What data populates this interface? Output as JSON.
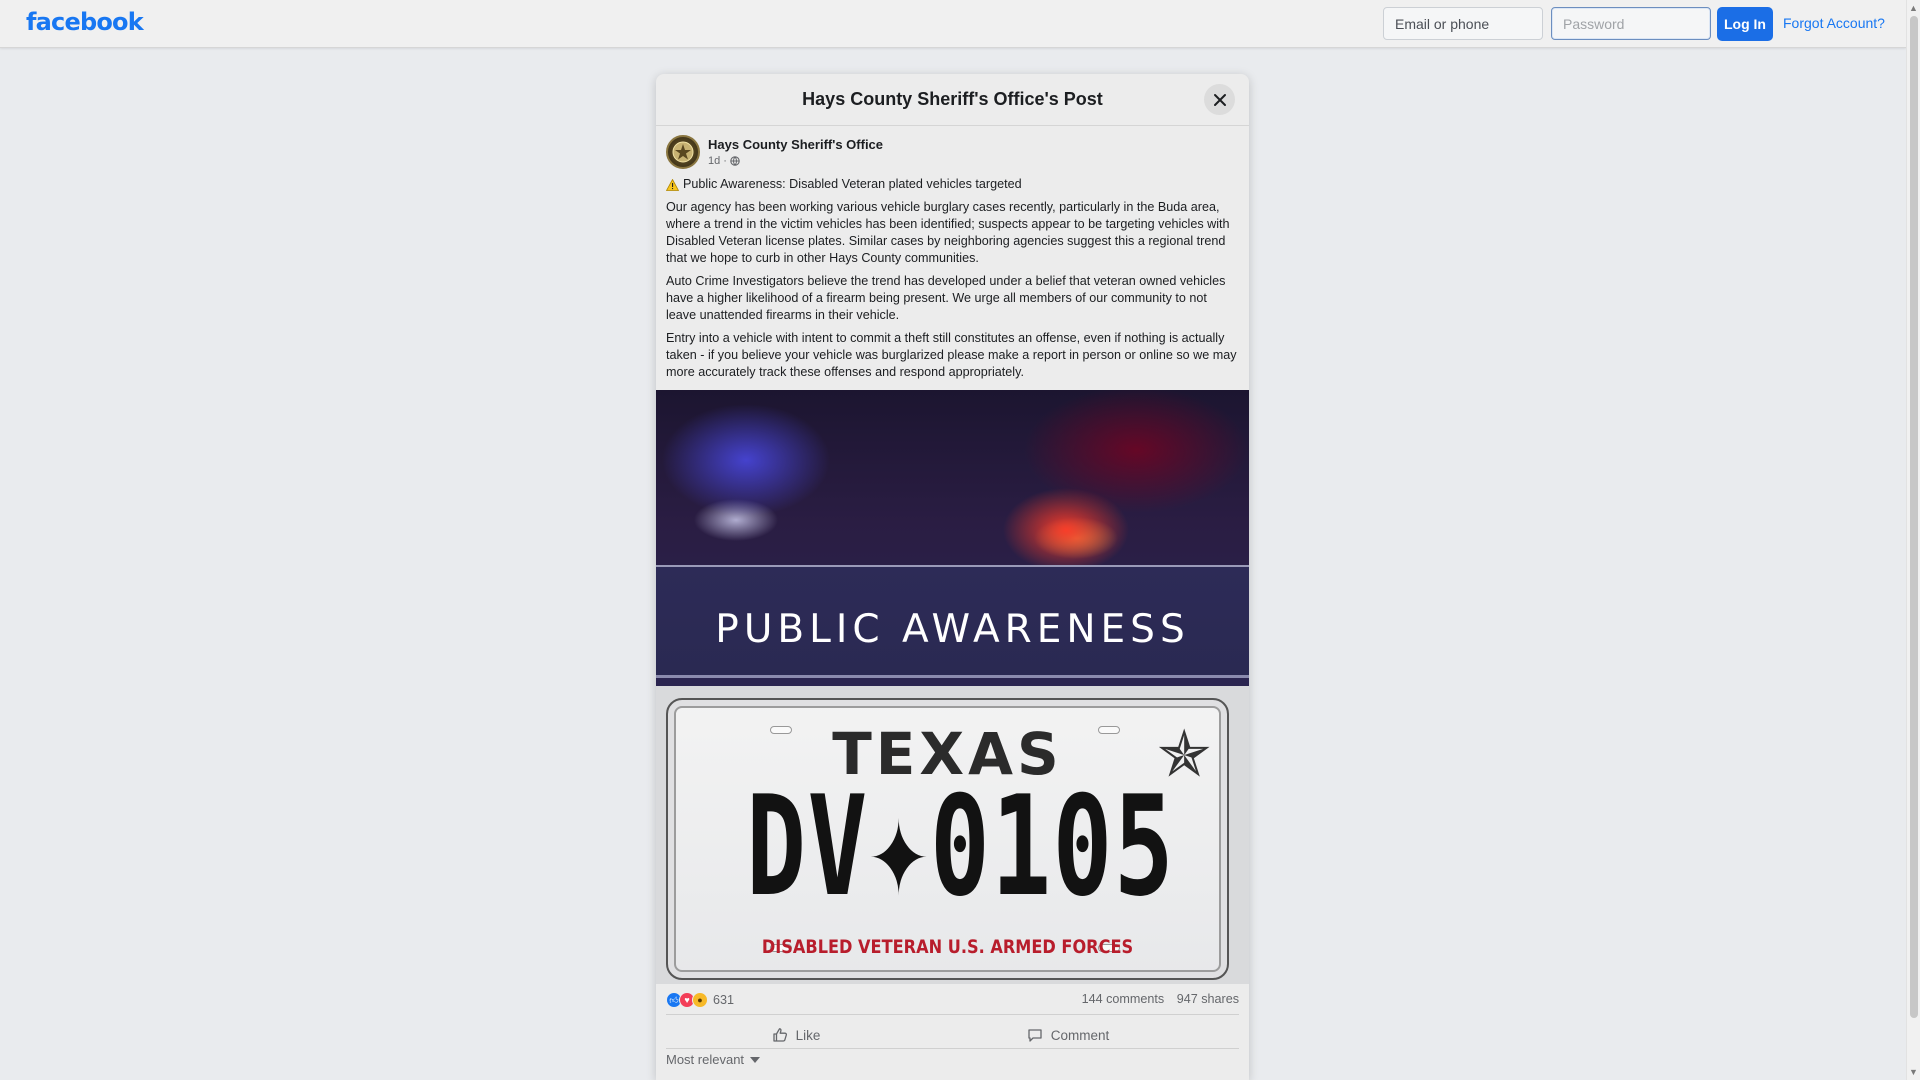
{
  "topbar": {
    "logo": "facebook",
    "email_placeholder": "Email or phone",
    "password_placeholder": "Password",
    "login_label": "Log In",
    "forgot_label": "Forgot Account?"
  },
  "post": {
    "dialog_title": "Hays County Sheriff's Office's Post",
    "author": "Hays County Sheriff's Office",
    "time": "1d",
    "separator": "·",
    "headline": "Public Awareness: Disabled Veteran plated vehicles targeted",
    "paragraphs": [
      "Our agency has been working various vehicle burglary cases recently, particularly in the Buda area, where a trend in the victim vehicles has been identified; suspects appear to be targeting vehicles with Disabled Veteran license plates. Similar cases by neighboring agencies suggest this a regional trend that we hope to curb in other Hays County communities.",
      "Auto Crime Investigators believe the trend has developed under a belief that veteran owned vehicles have a higher likelihood of a firearm being present. We urge all members of our community to not leave unattended firearms in their vehicle.",
      "Entry into a vehicle with intent to commit a theft still constitutes an offense, even if nothing is actually taken - if you believe your vehicle was burglarized please make a report in person or online so we may more accurately track these offenses and respond appropriately."
    ],
    "image": {
      "banner_text": "PUBLIC AWARENESS",
      "plate_state": "TEXAS",
      "plate_number": "DV✦0105",
      "plate_caption": "DISABLED VETERAN U.S. ARMED FORCES"
    },
    "reaction_count": "631",
    "comments": "144 comments",
    "shares": "947 shares",
    "like_label": "Like",
    "comment_label": "Comment",
    "sort_label": "Most relevant"
  },
  "icons": [
    "close-icon",
    "globe-icon",
    "warning-icon",
    "like-icon",
    "comment-icon",
    "chevron-down-icon",
    "star-icon"
  ],
  "colors": {
    "brand": "#1877f2",
    "login_button": "#1b6ee6",
    "plate_caption": "#b81d2c",
    "like_reaction": "#1877f2",
    "love_reaction": "#f33e58",
    "wow_reaction": "#f7b928"
  }
}
